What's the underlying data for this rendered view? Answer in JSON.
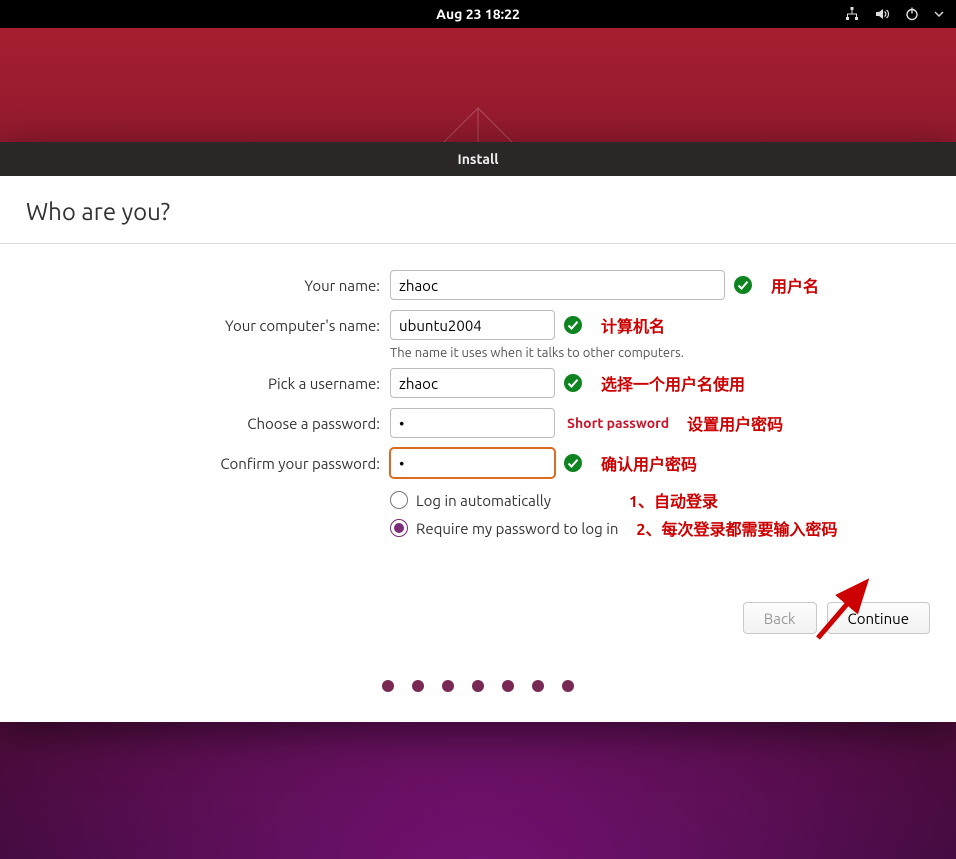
{
  "topbar": {
    "datetime": "Aug 23  18:22"
  },
  "window": {
    "title": "Install"
  },
  "page": {
    "heading": "Who are you?",
    "name_label": "Your name:",
    "name_value": "zhaoc",
    "computer_label": "Your computer's name:",
    "computer_value": "ubuntu2004",
    "computer_hint": "The name it uses when it talks to other computers.",
    "username_label": "Pick a username:",
    "username_value": "zhaoc",
    "password_label": "Choose a password:",
    "password_value": "•",
    "password_warning": "Short password",
    "confirm_label": "Confirm your password:",
    "confirm_value": "•",
    "radio_auto": "Log in automatically",
    "radio_require": "Require my password to log in",
    "back_label": "Back",
    "continue_label": "Continue"
  },
  "annotations": {
    "name": "用户名",
    "computer": "计算机名",
    "username": "选择一个用户名使用",
    "password": "设置用户密码",
    "confirm": "确认用户密码",
    "auto": "1、自动登录",
    "require": "2、每次登录都需要输入密码"
  },
  "dot_count": 7
}
